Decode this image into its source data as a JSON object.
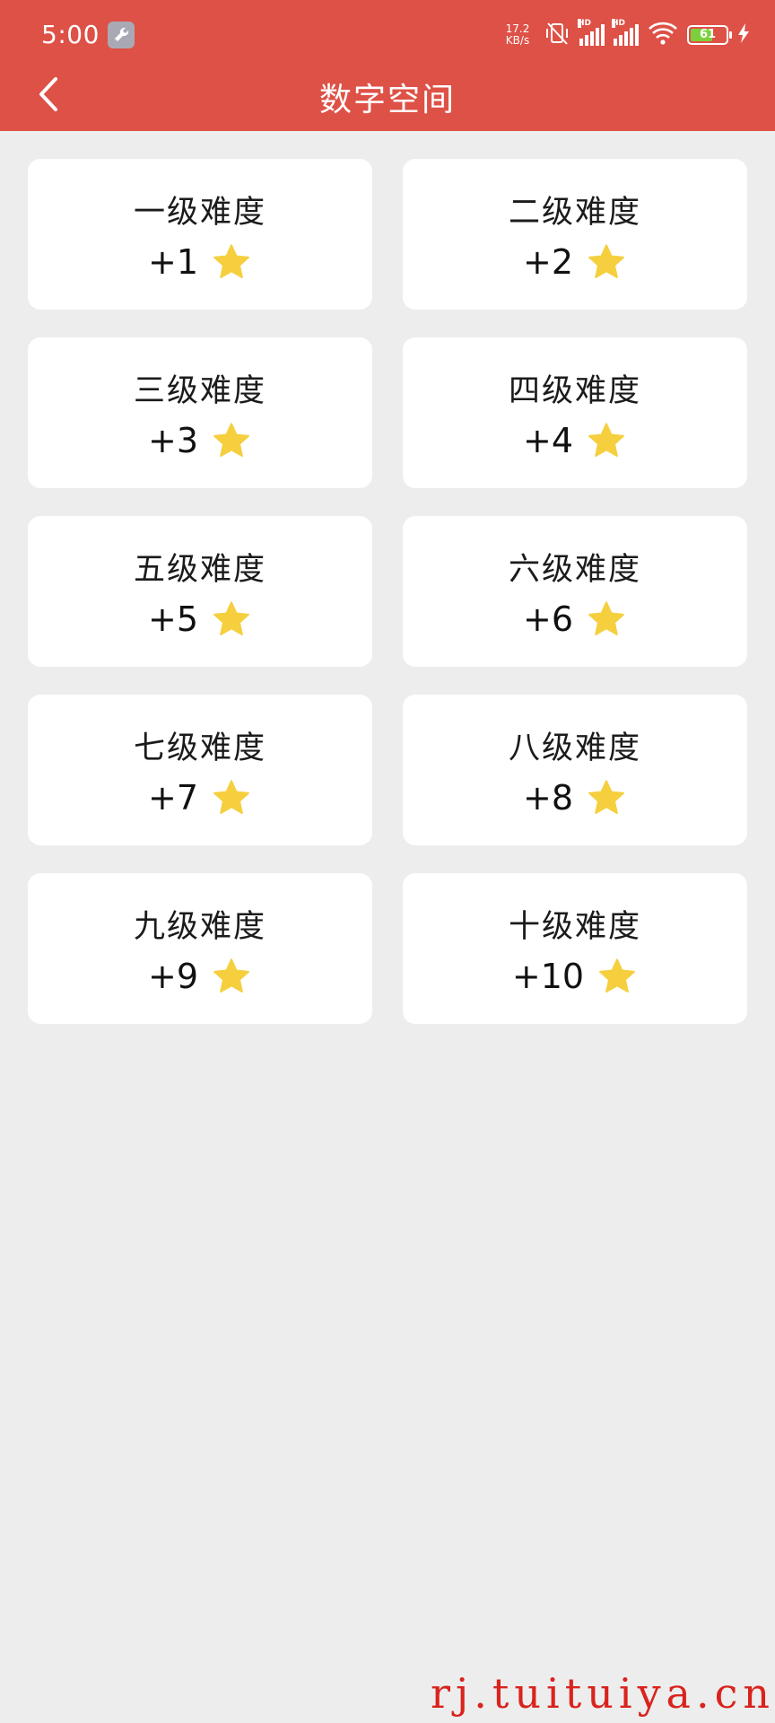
{
  "status_bar": {
    "time": "5:00",
    "net_speed_value": "17.2",
    "net_speed_unit": "KB/s",
    "signal_label_1": "HD",
    "signal_label_2": "HD",
    "battery_level": "61"
  },
  "header": {
    "title": "数字空间",
    "back_icon": "chevron-left-icon"
  },
  "levels": [
    {
      "title": "一级难度",
      "reward": "+1",
      "icon": "star-icon"
    },
    {
      "title": "二级难度",
      "reward": "+2",
      "icon": "star-icon"
    },
    {
      "title": "三级难度",
      "reward": "+3",
      "icon": "star-icon"
    },
    {
      "title": "四级难度",
      "reward": "+4",
      "icon": "star-icon"
    },
    {
      "title": "五级难度",
      "reward": "+5",
      "icon": "star-icon"
    },
    {
      "title": "六级难度",
      "reward": "+6",
      "icon": "star-icon"
    },
    {
      "title": "七级难度",
      "reward": "+7",
      "icon": "star-icon"
    },
    {
      "title": "八级难度",
      "reward": "+8",
      "icon": "star-icon"
    },
    {
      "title": "九级难度",
      "reward": "+9",
      "icon": "star-icon"
    },
    {
      "title": "十级难度",
      "reward": "+10",
      "icon": "star-icon"
    }
  ],
  "watermark": "rj.tuituiya.cn",
  "colors": {
    "header_bg": "#de5147",
    "page_bg": "#ededed",
    "card_bg": "#ffffff",
    "star": "#f5cf3e",
    "watermark": "#d9231d"
  }
}
